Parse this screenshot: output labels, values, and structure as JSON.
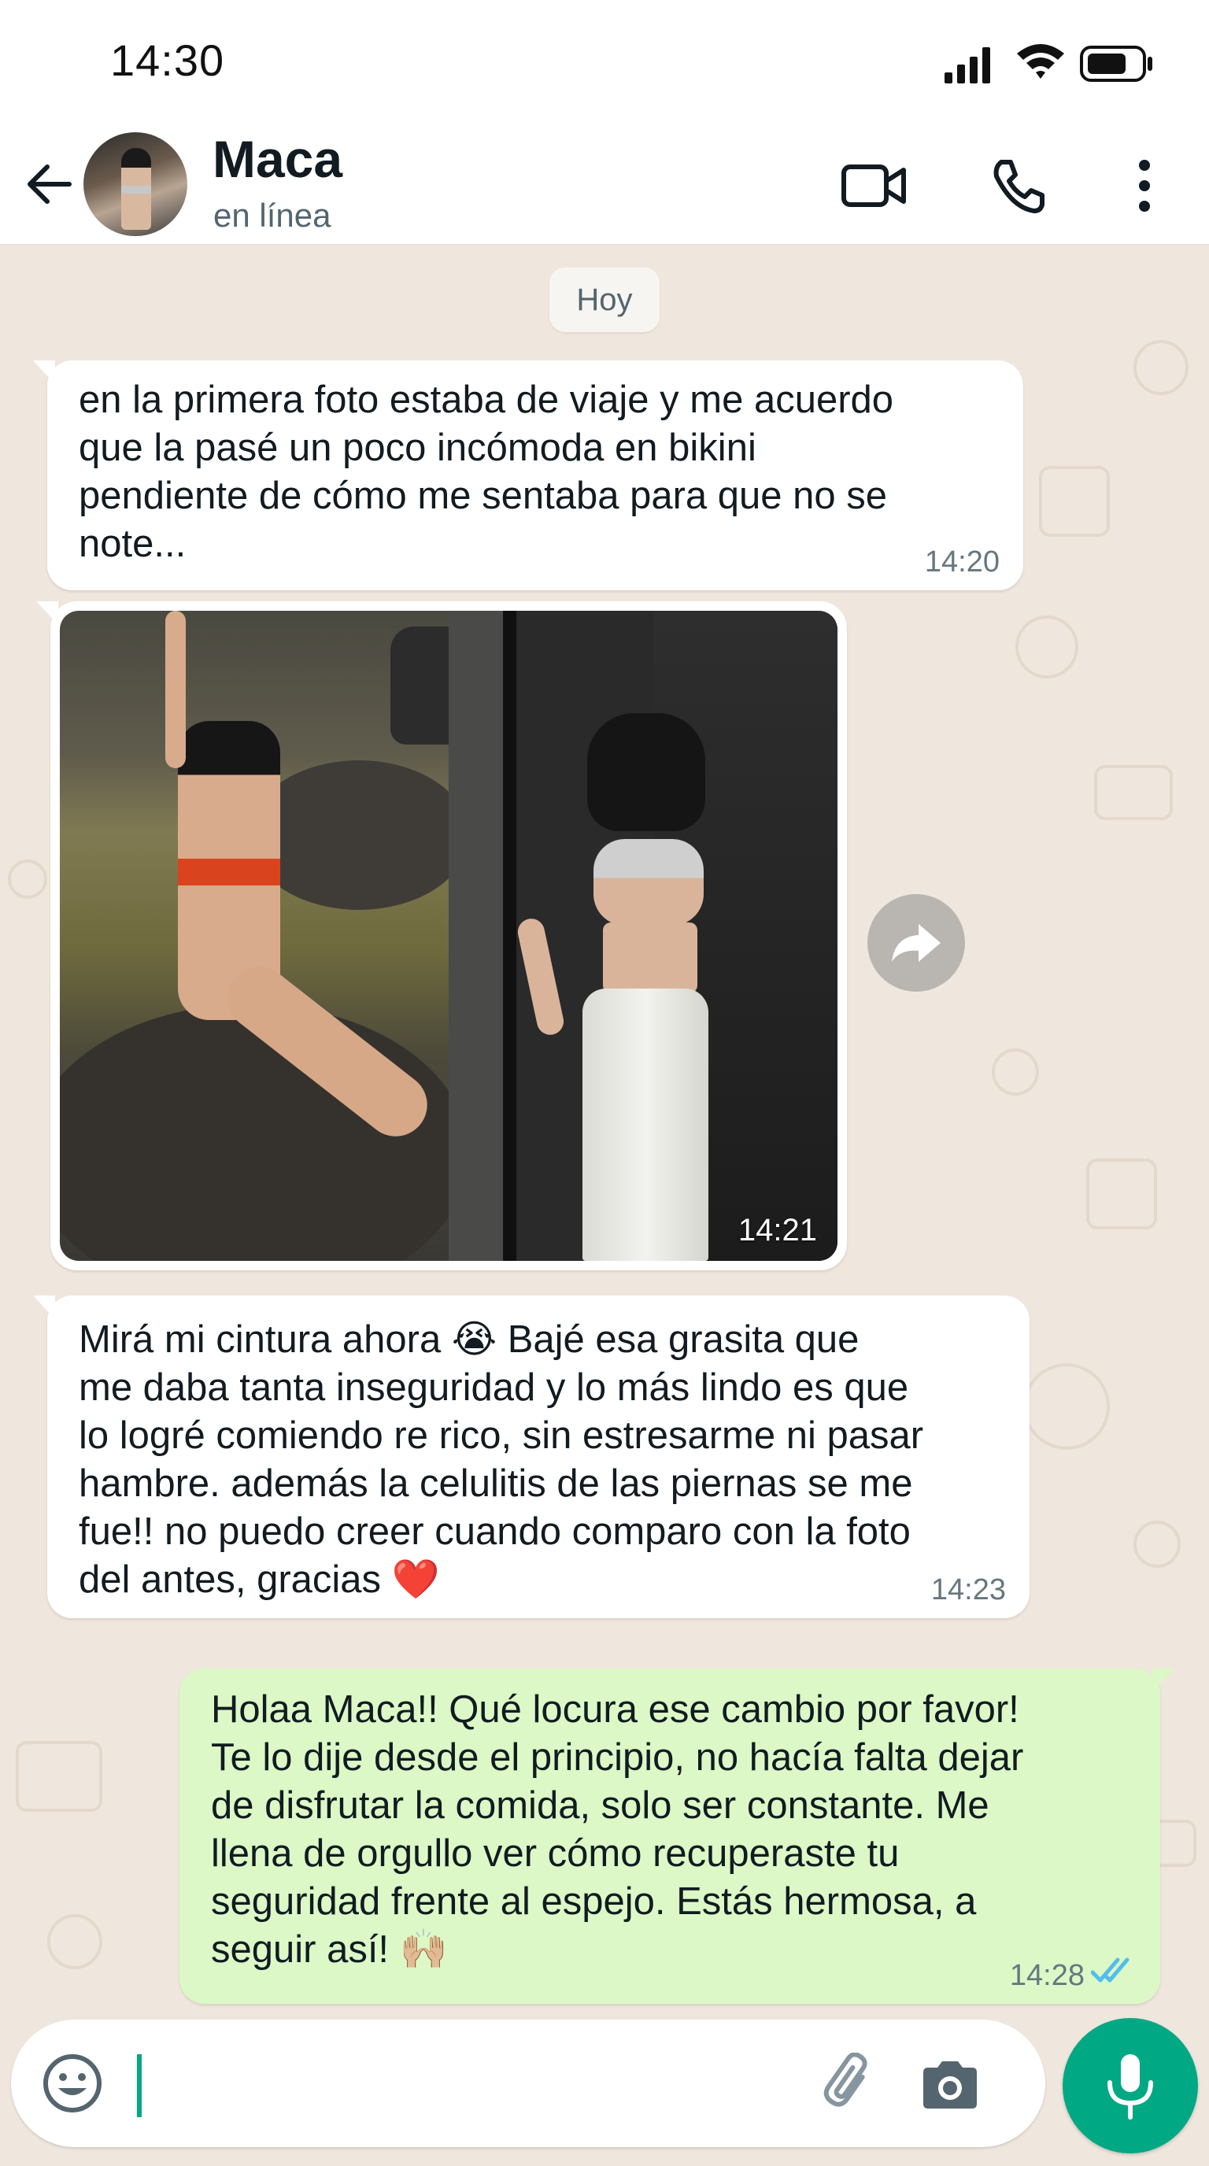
{
  "status_bar": {
    "time": "14:30"
  },
  "header": {
    "contact_name": "Maca",
    "contact_status": "en línea",
    "icons": [
      "back-arrow-icon",
      "video-call-icon",
      "voice-call-icon",
      "more-options-icon"
    ]
  },
  "chat": {
    "date_chip": "Hoy",
    "messages": [
      {
        "direction": "in",
        "text": "en la primera foto estaba de viaje y me acuerdo\nque la pasé un poco incómoda en bikini\npendiente de cómo me sentaba para que no se\nnote...",
        "time": "14:20"
      },
      {
        "direction": "in",
        "type": "photo",
        "time": "14:21"
      },
      {
        "direction": "in",
        "text": "Mirá mi cintura ahora 😭 Bajé esa grasita que\nme daba tanta inseguridad y lo más lindo es que\nlo logré comiendo re rico, sin estresarme ni pasar\nhambre. además la celulitis de las piernas se me\nfue!! no puedo creer cuando comparo con la foto\ndel antes, gracias ❤️",
        "time": "14:23"
      },
      {
        "direction": "out",
        "text": "Holaa Maca!! Qué locura ese cambio por favor!\nTe lo dije desde el principio, no hacía falta dejar\nde disfrutar la comida, solo ser constante. Me\nllena de orgullo ver cómo recuperaste tu\nseguridad frente al espejo. Estás hermosa, a\nseguir así! 🙌🏼",
        "time": "14:28",
        "status": "read"
      }
    ]
  },
  "input_bar": {
    "value": "",
    "icons": [
      "emoji-icon",
      "attach-icon",
      "camera-icon",
      "mic-icon"
    ]
  },
  "colors": {
    "accent": "#00a884",
    "outgoing_bubble": "#dcf8c6",
    "incoming_bubble": "#ffffff",
    "chat_background": "#efe7dd",
    "read_ticks": "#53bdeb"
  }
}
